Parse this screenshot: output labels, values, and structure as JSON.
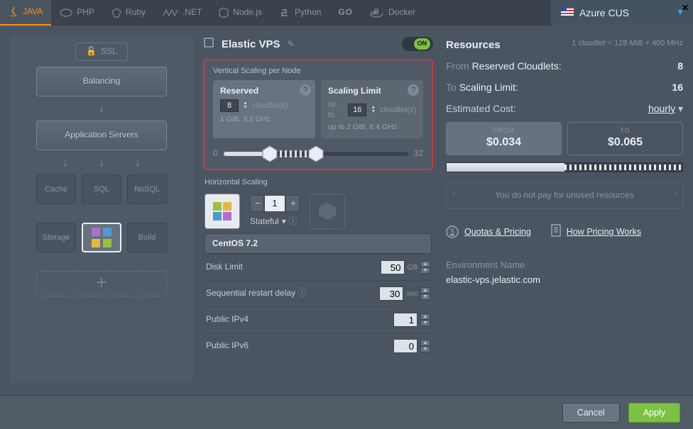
{
  "tabs": {
    "java": {
      "label": "JAVA",
      "active": true,
      "icon": "java"
    },
    "php": {
      "label": "PHP",
      "active": false,
      "icon": "php"
    },
    "ruby": {
      "label": "Ruby",
      "active": false,
      "icon": "ruby"
    },
    "dotnet": {
      "label": ".NET",
      "active": false,
      "icon": "dotnet"
    },
    "node": {
      "label": "Node.js",
      "active": false,
      "icon": "node"
    },
    "python": {
      "label": "Python",
      "active": false,
      "icon": "python"
    },
    "go": {
      "label": "GO",
      "active": false,
      "icon": "go"
    },
    "docker": {
      "label": "Docker",
      "active": false,
      "icon": "docker"
    }
  },
  "region": {
    "label": "Azure CUS",
    "flag": "us"
  },
  "left": {
    "ssl": "SSL",
    "balancing": "Balancing",
    "appservers": "Application Servers",
    "cache": "Cache",
    "sql": "SQL",
    "nosql": "NoSQL",
    "storage": "Storage",
    "build": "Build"
  },
  "mid": {
    "title": "Elastic VPS",
    "switch": "ON",
    "vertical_label": "Vertical Scaling per Node",
    "reserved": {
      "title": "Reserved",
      "value": "8",
      "unit": "cloudlet(s)",
      "sub": "1 GiB, 3.2 GHz"
    },
    "limit": {
      "title": "Scaling Limit",
      "prefix": "up to",
      "value": "16",
      "unit": "cloudlet(s)",
      "sub_prefix": "up to",
      "sub": "2 GiB, 6.4 GHz"
    },
    "slider": {
      "min": "0",
      "max": "32"
    },
    "horizontal_label": "Horizontal Scaling",
    "hcount": "1",
    "stateful": "Stateful",
    "os": "CentOS 7.2",
    "props": {
      "disk": {
        "label": "Disk Limit",
        "value": "50",
        "unit": "GB"
      },
      "delay": {
        "label": "Sequential restart delay",
        "value": "30",
        "unit": "sec"
      },
      "ipv4": {
        "label": "Public IPv4",
        "value": "1"
      },
      "ipv6": {
        "label": "Public IPv6",
        "value": "0"
      }
    }
  },
  "right": {
    "resources": "Resources",
    "cloudlet_eq": "1 cloudlet = 128 MiB + 400 MHz",
    "from": {
      "pre": "From",
      "label": "Reserved Cloudlets:",
      "value": "8"
    },
    "to": {
      "pre": "To",
      "label": "Scaling Limit:",
      "value": "16"
    },
    "ec": {
      "label": "Estimated Cost:",
      "period": "hourly"
    },
    "cost": {
      "from_lbl": "FROM",
      "from": "$0.034",
      "to_lbl": "TO",
      "to": "$0.065"
    },
    "note": "You do not pay for unused resources",
    "links": {
      "quotas": "Quotas & Pricing",
      "how": "How Pricing Works"
    },
    "env_label": "Environment Name",
    "env_value": "elastic-vps.jelastic.com"
  },
  "footer": {
    "cancel": "Cancel",
    "apply": "Apply"
  }
}
